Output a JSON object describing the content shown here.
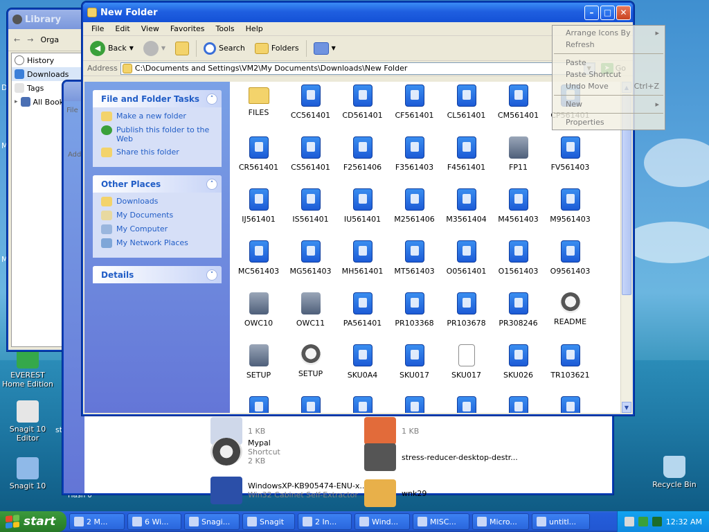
{
  "library": {
    "title": "Library",
    "toolbar_partial": "Orga",
    "items": [
      {
        "label": "History",
        "icon": "history-icon"
      },
      {
        "label": "Downloads",
        "icon": "download-icon"
      },
      {
        "label": "Tags",
        "icon": "tag-icon"
      },
      {
        "label": "All Bookr",
        "icon": "bookmark-icon"
      }
    ]
  },
  "window2": {
    "rows": [
      {
        "name": "",
        "sub": "1 KB"
      },
      {
        "name": "",
        "sub": "1 KB"
      },
      {
        "name": "Mypal",
        "sub": "Shortcut",
        "sub2": "2 KB"
      },
      {
        "name": "stress-reducer-desktop-destr...",
        "sub": ""
      },
      {
        "name": "WindowsXP-KB905474-ENU-x...",
        "sub": "Win32 Cabinet Self-Extractor"
      },
      {
        "name": "wnk29",
        "sub": ""
      }
    ],
    "partial_labels": {
      "file": "File",
      "add": "Add"
    }
  },
  "main": {
    "title": "New Folder",
    "menu": [
      "File",
      "Edit",
      "View",
      "Favorites",
      "Tools",
      "Help"
    ],
    "toolbar": {
      "back": "Back",
      "search": "Search",
      "folders": "Folders"
    },
    "address": {
      "label": "Address",
      "value": "C:\\Documents and Settings\\VM2\\My Documents\\Downloads\\New Folder",
      "go": "Go"
    },
    "tasks": {
      "file_folder": {
        "title": "File and Folder Tasks",
        "items": [
          "Make a new folder",
          "Publish this folder to the Web",
          "Share this folder"
        ]
      },
      "other_places": {
        "title": "Other Places",
        "items": [
          "Downloads",
          "My Documents",
          "My Computer",
          "My Network Places"
        ]
      },
      "details": {
        "title": "Details"
      }
    },
    "files": [
      {
        "name": "FILES",
        "type": "folder"
      },
      {
        "name": "CC561401",
        "type": "installer"
      },
      {
        "name": "CD561401",
        "type": "installer"
      },
      {
        "name": "CF561401",
        "type": "installer"
      },
      {
        "name": "CL561401",
        "type": "installer"
      },
      {
        "name": "CM561401",
        "type": "installer"
      },
      {
        "name": "CP561401",
        "type": "installer"
      },
      {
        "name": "CR561401",
        "type": "installer"
      },
      {
        "name": "CS561401",
        "type": "installer"
      },
      {
        "name": "F2561406",
        "type": "installer"
      },
      {
        "name": "F3561403",
        "type": "installer"
      },
      {
        "name": "F4561401",
        "type": "installer"
      },
      {
        "name": "FP11",
        "type": "setup"
      },
      {
        "name": "FV561403",
        "type": "installer"
      },
      {
        "name": "IJ561401",
        "type": "installer"
      },
      {
        "name": "IS561401",
        "type": "installer"
      },
      {
        "name": "IU561401",
        "type": "installer"
      },
      {
        "name": "M2561406",
        "type": "installer"
      },
      {
        "name": "M3561404",
        "type": "installer"
      },
      {
        "name": "M4561403",
        "type": "installer"
      },
      {
        "name": "M9561403",
        "type": "installer"
      },
      {
        "name": "MC561403",
        "type": "installer"
      },
      {
        "name": "MG561403",
        "type": "installer"
      },
      {
        "name": "MH561401",
        "type": "installer"
      },
      {
        "name": "MT561403",
        "type": "installer"
      },
      {
        "name": "O0561401",
        "type": "installer"
      },
      {
        "name": "O1561403",
        "type": "installer"
      },
      {
        "name": "O9561403",
        "type": "installer"
      },
      {
        "name": "OWC10",
        "type": "setup"
      },
      {
        "name": "OWC11",
        "type": "setup"
      },
      {
        "name": "PA561401",
        "type": "installer"
      },
      {
        "name": "PR103368",
        "type": "installer"
      },
      {
        "name": "PR103678",
        "type": "installer"
      },
      {
        "name": "PR308246",
        "type": "installer"
      },
      {
        "name": "README",
        "type": "raccoon"
      },
      {
        "name": "SETUP",
        "type": "setup"
      },
      {
        "name": "SETUP",
        "type": "raccoon"
      },
      {
        "name": "SKU0A4",
        "type": "installer"
      },
      {
        "name": "SKU017",
        "type": "installer"
      },
      {
        "name": "SKU017",
        "type": "doc"
      },
      {
        "name": "SKU026",
        "type": "installer"
      },
      {
        "name": "TR103621",
        "type": "installer"
      },
      {
        "name": "",
        "type": "installer"
      },
      {
        "name": "",
        "type": "installer"
      },
      {
        "name": "",
        "type": "installer"
      },
      {
        "name": "",
        "type": "installer"
      },
      {
        "name": "",
        "type": "installer"
      },
      {
        "name": "",
        "type": "installer"
      },
      {
        "name": "",
        "type": "installer"
      }
    ]
  },
  "context_menu": {
    "items": [
      {
        "label": "Arrange Icons By",
        "submenu": true
      },
      {
        "label": "Refresh"
      },
      {
        "sep": true
      },
      {
        "label": "Paste"
      },
      {
        "label": "Paste Shortcut"
      },
      {
        "label": "Undo Move",
        "shortcut": "Ctrl+Z"
      },
      {
        "sep": true
      },
      {
        "label": "New",
        "submenu": true
      },
      {
        "sep": true
      },
      {
        "label": "Properties"
      }
    ]
  },
  "desktop": {
    "icons": [
      {
        "label": "EVEREST Home Edition"
      },
      {
        "label": "Snagit 10 Editor"
      },
      {
        "label": "Snagit 10"
      },
      {
        "label": "Recycle Bin"
      }
    ],
    "edge_labels": {
      "a": "D",
      "b": "M",
      "c": "M",
      "d": "st",
      "e": "Hash 0"
    }
  },
  "taskbar": {
    "start": "start",
    "buttons": [
      "2 M...",
      "6 Wi...",
      "Snagi...",
      "Snagit",
      "2 In...",
      "Wind...",
      "MISC...",
      "Micro...",
      "untitl..."
    ],
    "clock": "12:32 AM"
  },
  "colors": {
    "xp_blue": "#245edb",
    "task_link": "#215dc6",
    "start_green": "#3d9a3d"
  }
}
